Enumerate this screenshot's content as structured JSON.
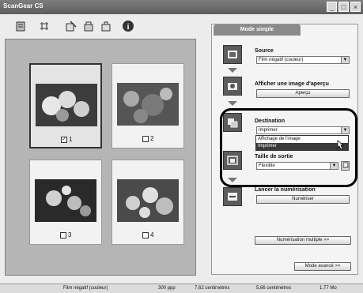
{
  "window": {
    "title": "ScanGear CS"
  },
  "toolbar": {
    "buttons": [
      {
        "icon": "rotate-icon"
      },
      {
        "icon": "crop-icon"
      },
      {
        "icon": "auto-crop-icon"
      },
      {
        "icon": "mirror-icon"
      },
      {
        "icon": "invert-icon"
      },
      {
        "icon": "info-icon"
      }
    ]
  },
  "thumbnails": [
    {
      "label": "1",
      "checked": true
    },
    {
      "label": "2",
      "checked": false
    },
    {
      "label": "3",
      "checked": false
    },
    {
      "label": "4",
      "checked": false
    }
  ],
  "tab": {
    "label": "Mode simple"
  },
  "source": {
    "label": "Source",
    "value": "Film négatif (couleur)"
  },
  "preview": {
    "label": "Afficher une image d'aperçu",
    "button": "Aperçu"
  },
  "destination": {
    "label": "Destination",
    "value": "Imprimer",
    "options": [
      "Affichage de l'image",
      "Imprimer"
    ]
  },
  "output_size": {
    "label": "Taille de sortie",
    "value": "Flexible"
  },
  "scan": {
    "label": "Lancer la numérisation",
    "button": "Numériser"
  },
  "multi_scan": {
    "button": "Numérisation multiple >>"
  },
  "advanced": {
    "button": "Mode avancé >>"
  },
  "status": {
    "film": "Film négatif (couleur)",
    "resolution": "300 ppp",
    "width": "7,62 centimètres",
    "height": "5,66 centimètres",
    "size": "1,77 Mo"
  }
}
